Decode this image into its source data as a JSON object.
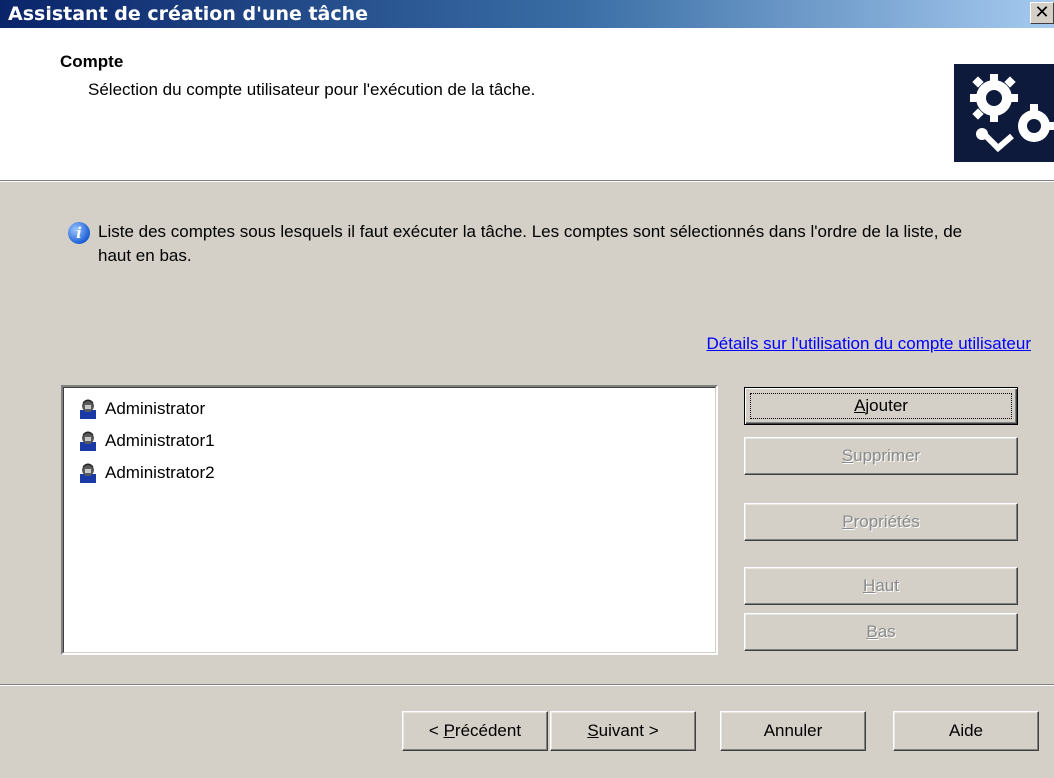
{
  "window": {
    "title": "Assistant de création d'une tâche",
    "close_label": "✕"
  },
  "header": {
    "title": "Compte",
    "subtitle": "Sélection du compte utilisateur pour l'exécution de la tâche.",
    "icon": "gears-icon"
  },
  "info": {
    "icon": "info-icon",
    "text": "Liste des comptes sous lesquels il faut exécuter la tâche. Les comptes sont sélectionnés dans l'ordre de la liste, de haut en bas."
  },
  "details_link": "Détails sur l'utilisation du compte utilisateur",
  "accounts": [
    {
      "name": "Administrator",
      "icon": "user-icon"
    },
    {
      "name": "Administrator1",
      "icon": "user-icon"
    },
    {
      "name": "Administrator2",
      "icon": "user-icon"
    }
  ],
  "side_buttons": {
    "add": {
      "pre": "",
      "mnemonic": "A",
      "post": "jouter",
      "enabled": true
    },
    "remove": {
      "pre": "",
      "mnemonic": "S",
      "post": "upprimer",
      "enabled": false
    },
    "properties": {
      "pre": "",
      "mnemonic": "P",
      "post": "ropriétés",
      "enabled": false
    },
    "up": {
      "pre": "",
      "mnemonic": "H",
      "post": "aut",
      "enabled": false
    },
    "down": {
      "pre": "",
      "mnemonic": "B",
      "post": "as",
      "enabled": false
    }
  },
  "footer_buttons": {
    "back": {
      "pre": "< ",
      "mnemonic": "P",
      "post": "récédent"
    },
    "next": {
      "pre": "",
      "mnemonic": "S",
      "post": "uivant >"
    },
    "cancel": {
      "pre": "Annuler",
      "mnemonic": "",
      "post": ""
    },
    "help": {
      "pre": "Aide",
      "mnemonic": "",
      "post": ""
    }
  },
  "colors": {
    "titlebar_start": "#0a246a",
    "titlebar_end": "#a6caf0",
    "dialog_bg": "#d4d0c8",
    "link": "#0000ff"
  }
}
